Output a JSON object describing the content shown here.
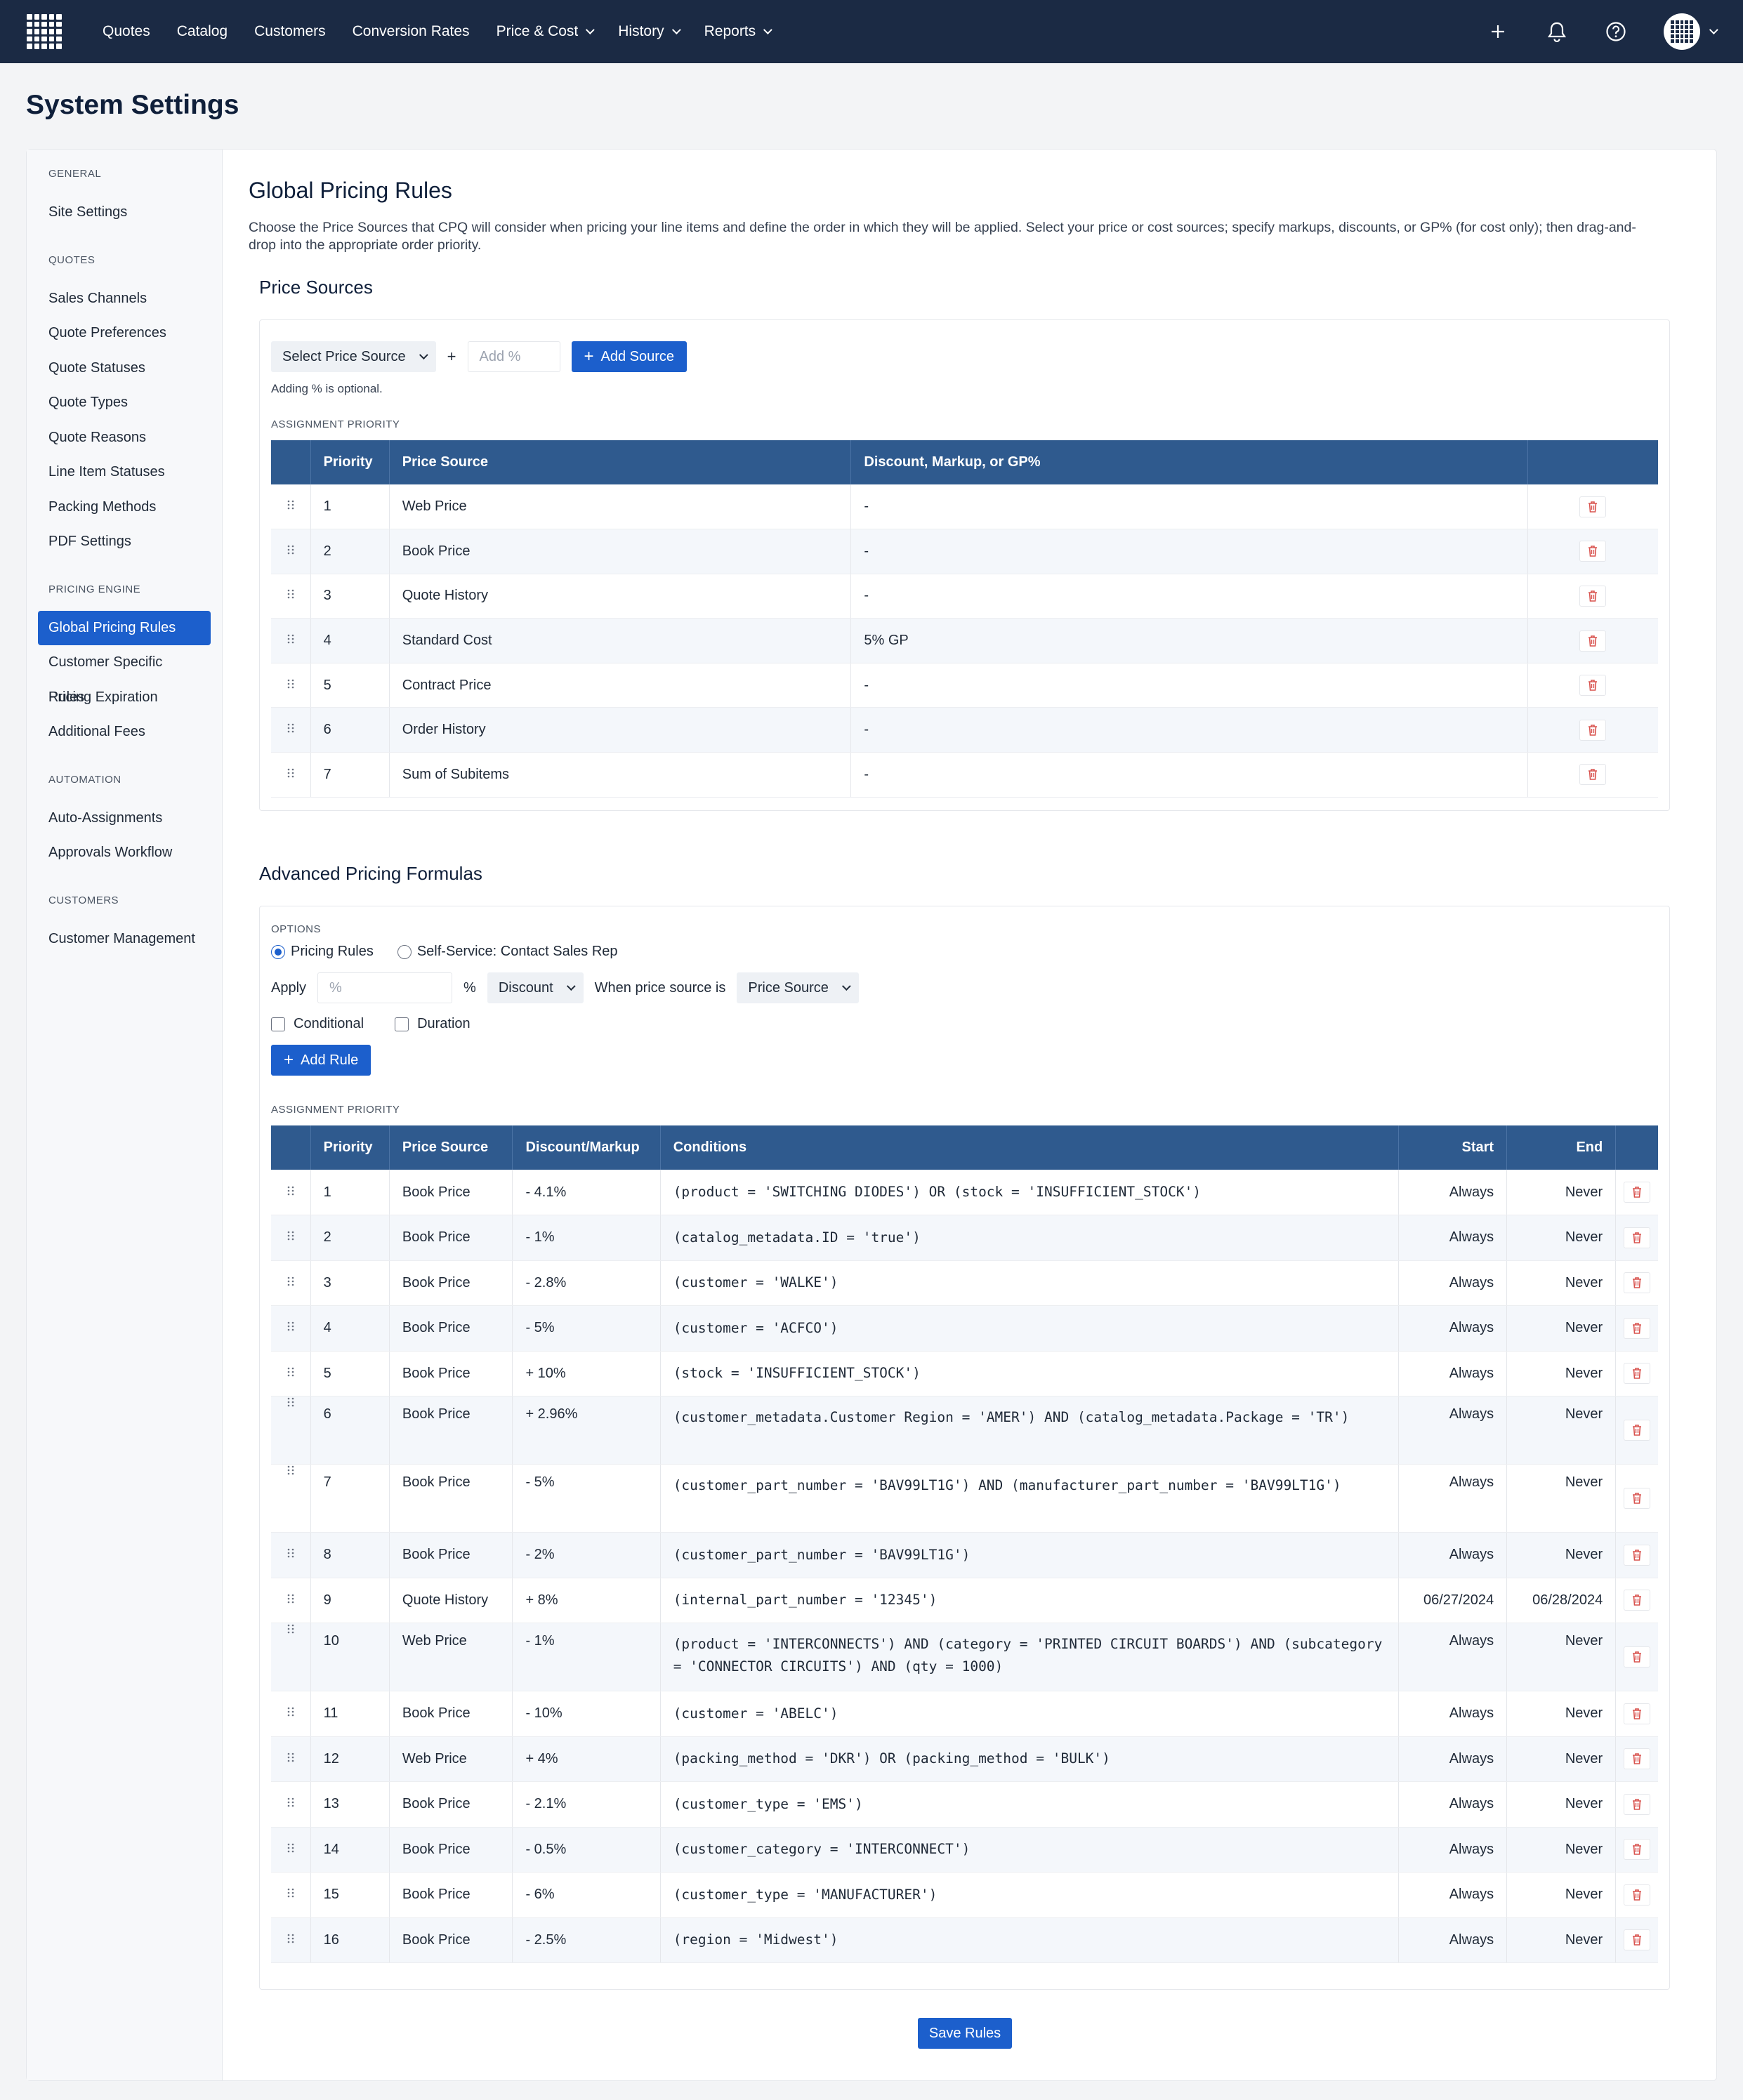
{
  "nav": {
    "items": [
      "Quotes",
      "Catalog",
      "Customers",
      "Conversion Rates",
      "Price & Cost",
      "History",
      "Reports"
    ],
    "dropdowns": [
      false,
      false,
      false,
      false,
      true,
      true,
      true
    ]
  },
  "page_title": "System Settings",
  "sidebar": {
    "sections": [
      {
        "title": "GENERAL",
        "items": [
          "Site Settings"
        ]
      },
      {
        "title": "QUOTES",
        "items": [
          "Sales Channels",
          "Quote Preferences",
          "Quote Statuses",
          "Quote Types",
          "Quote Reasons",
          "Line Item Statuses",
          "Packing Methods",
          "PDF Settings"
        ]
      },
      {
        "title": "PRICING ENGINE",
        "items": [
          "Global Pricing Rules",
          "Customer Specific Rules",
          "Pricing Expiration",
          "Additional Fees"
        ]
      },
      {
        "title": "AUTOMATION",
        "items": [
          "Auto-Assignments",
          "Approvals Workflow"
        ]
      },
      {
        "title": "CUSTOMERS",
        "items": [
          "Customer Management"
        ]
      }
    ],
    "active": "Global Pricing Rules"
  },
  "main": {
    "title": "Global Pricing Rules",
    "description": "Choose the Price Sources that CPQ will consider when pricing your line items and define the order in which they will be applied. Select your price or cost sources; specify markups, discounts, or GP% (for cost only); then drag-and-drop into the appropriate order priority.",
    "price_sources": {
      "title": "Price Sources",
      "select_label": "Select Price Source",
      "plus": "+",
      "add_placeholder": "Add %",
      "add_button": "Add Source",
      "hint": "Adding % is optional.",
      "priority_label": "ASSIGNMENT PRIORITY",
      "columns": [
        "Priority",
        "Price Source",
        "Discount, Markup, or GP%"
      ],
      "rows": [
        {
          "priority": "1",
          "source": "Web Price",
          "value": "-"
        },
        {
          "priority": "2",
          "source": "Book Price",
          "value": "-"
        },
        {
          "priority": "3",
          "source": "Quote History",
          "value": "-"
        },
        {
          "priority": "4",
          "source": "Standard Cost",
          "value": "5% GP"
        },
        {
          "priority": "5",
          "source": "Contract Price",
          "value": "-"
        },
        {
          "priority": "6",
          "source": "Order History",
          "value": "-"
        },
        {
          "priority": "7",
          "source": "Sum of Subitems",
          "value": "-"
        }
      ]
    },
    "advanced": {
      "title": "Advanced Pricing Formulas",
      "options_label": "OPTIONS",
      "radio_1": "Pricing Rules",
      "radio_2": "Self-Service: Contact Sales Rep",
      "apply_label": "Apply",
      "percent_placeholder": "%",
      "percent_sign": "%",
      "discount_select": "Discount",
      "when_label": "When price source is",
      "source_select": "Price Source",
      "conditional_label": "Conditional",
      "duration_label": "Duration",
      "add_rule": "Add Rule",
      "priority_label": "ASSIGNMENT PRIORITY",
      "columns": [
        "Priority",
        "Price Source",
        "Discount/Markup",
        "Conditions",
        "Start",
        "End"
      ],
      "rows": [
        {
          "priority": "1",
          "source": "Book Price",
          "adj": "- 4.1%",
          "cond": "(product = 'SWITCHING DIODES') OR (stock = 'INSUFFICIENT_STOCK')",
          "start": "Always",
          "end": "Never"
        },
        {
          "priority": "2",
          "source": "Book Price",
          "adj": "- 1%",
          "cond": "(catalog_metadata.ID = 'true')",
          "start": "Always",
          "end": "Never"
        },
        {
          "priority": "3",
          "source": "Book Price",
          "adj": "- 2.8%",
          "cond": "(customer = 'WALKE')",
          "start": "Always",
          "end": "Never"
        },
        {
          "priority": "4",
          "source": "Book Price",
          "adj": "- 5%",
          "cond": "(customer = 'ACFCO')",
          "start": "Always",
          "end": "Never"
        },
        {
          "priority": "5",
          "source": "Book Price",
          "adj": "+ 10%",
          "cond": "(stock = 'INSUFFICIENT_STOCK')",
          "start": "Always",
          "end": "Never"
        },
        {
          "priority": "6",
          "source": "Book Price",
          "adj": "+ 2.96%",
          "cond": "(customer_metadata.Customer Region = 'AMER') AND (catalog_metadata.Package = 'TR')",
          "start": "Always",
          "end": "Never"
        },
        {
          "priority": "7",
          "source": "Book Price",
          "adj": "- 5%",
          "cond": "(customer_part_number = 'BAV99LT1G') AND (manufacturer_part_number = 'BAV99LT1G')",
          "start": "Always",
          "end": "Never"
        },
        {
          "priority": "8",
          "source": "Book Price",
          "adj": "- 2%",
          "cond": "(customer_part_number = 'BAV99LT1G')",
          "start": "Always",
          "end": "Never"
        },
        {
          "priority": "9",
          "source": "Quote History",
          "adj": "+ 8%",
          "cond": "(internal_part_number = '12345')",
          "start": "06/27/2024",
          "end": "06/28/2024"
        },
        {
          "priority": "10",
          "source": "Web Price",
          "adj": "- 1%",
          "cond": "(product = 'INTERCONNECTS') AND (category = 'PRINTED CIRCUIT BOARDS') AND (subcategory = 'CONNECTOR CIRCUITS') AND (qty = 1000)",
          "start": "Always",
          "end": "Never"
        },
        {
          "priority": "11",
          "source": "Book Price",
          "adj": "- 10%",
          "cond": "(customer = 'ABELC')",
          "start": "Always",
          "end": "Never"
        },
        {
          "priority": "12",
          "source": "Web Price",
          "adj": "+ 4%",
          "cond": "(packing_method = 'DKR') OR (packing_method = 'BULK')",
          "start": "Always",
          "end": "Never"
        },
        {
          "priority": "13",
          "source": "Book Price",
          "adj": "- 2.1%",
          "cond": "(customer_type = 'EMS')",
          "start": "Always",
          "end": "Never"
        },
        {
          "priority": "14",
          "source": "Book Price",
          "adj": "- 0.5%",
          "cond": "(customer_category = 'INTERCONNECT')",
          "start": "Always",
          "end": "Never"
        },
        {
          "priority": "15",
          "source": "Book Price",
          "adj": "- 6%",
          "cond": "(customer_type = 'MANUFACTURER')",
          "start": "Always",
          "end": "Never"
        },
        {
          "priority": "16",
          "source": "Book Price",
          "adj": "- 2.5%",
          "cond": "(region = 'Midwest')",
          "start": "Always",
          "end": "Never"
        }
      ]
    },
    "save_button": "Save Rules"
  },
  "colors": {
    "nav_bg": "#1b2a44",
    "accent": "#1c5fcc",
    "table_header": "#2f5a8e",
    "delete": "#d9534f"
  }
}
